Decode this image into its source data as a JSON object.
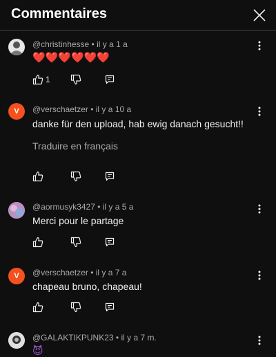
{
  "header": {
    "title": "Commentaires",
    "close_icon": "close-icon"
  },
  "translate_label": "Traduire en français",
  "comments": [
    {
      "author": "@christinhesse",
      "time": "il y a 1 a",
      "text": "❤️❤️❤️❤️❤️❤️",
      "likes": "1",
      "avatar_letter": "",
      "avatar_color": "#e8e8e8"
    },
    {
      "author": "@verschaetzer",
      "time": "il y a 10 a",
      "text": "danke für den upload, hab ewig danach gesucht!!",
      "likes": "",
      "avatar_letter": "V",
      "avatar_color": "#f4511e"
    },
    {
      "author": "@aormusyk3427",
      "time": "il y a 5 a",
      "text": "Merci pour le partage",
      "likes": "",
      "avatar_letter": "",
      "avatar_color": "#c9a0c8"
    },
    {
      "author": "@verschaetzer",
      "time": "il y a 7 a",
      "text": "chapeau bruno, chapeau!",
      "likes": "",
      "avatar_letter": "V",
      "avatar_color": "#f4511e"
    },
    {
      "author": "@GALAKTIKPUNK23",
      "time": "il y a 7 m.",
      "text": "😈",
      "likes": "",
      "avatar_letter": "",
      "avatar_color": "#cfcfcf"
    }
  ]
}
